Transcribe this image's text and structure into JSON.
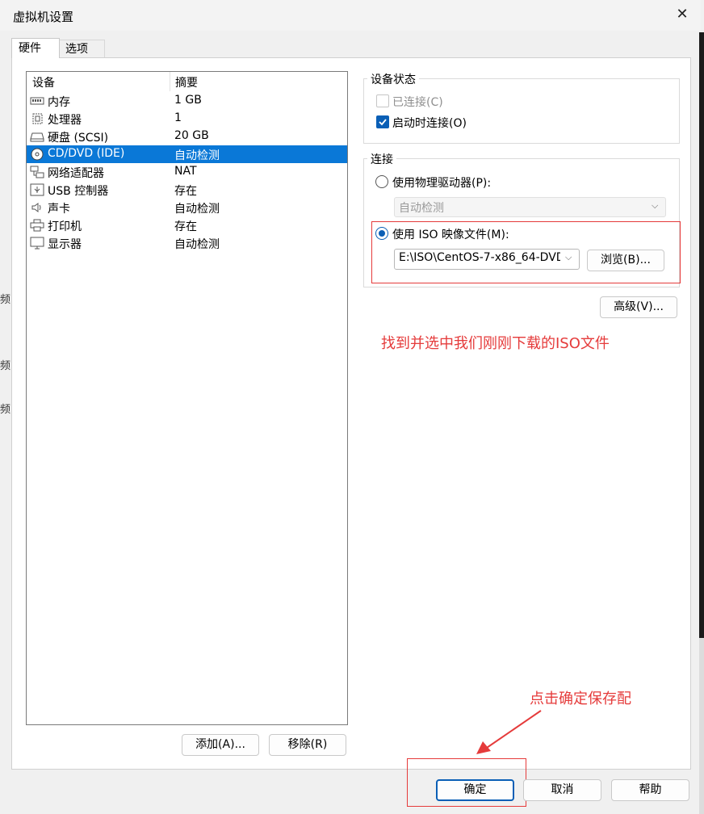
{
  "window": {
    "title": "虚拟机设置",
    "close_glyph": "✕"
  },
  "left_fragments": [
    "频",
    "频",
    "频"
  ],
  "tabs": [
    {
      "label": "硬件"
    },
    {
      "label": "选项"
    }
  ],
  "device_list": {
    "headers": {
      "device": "设备",
      "summary": "摘要"
    },
    "rows": [
      {
        "name": "内存",
        "summary": "1 GB",
        "icon": "memory-icon"
      },
      {
        "name": "处理器",
        "summary": "1",
        "icon": "processor-icon"
      },
      {
        "name": "硬盘 (SCSI)",
        "summary": "20 GB",
        "icon": "hard-disk-icon"
      },
      {
        "name": "CD/DVD (IDE)",
        "summary": "自动检测",
        "icon": "cd-dvd-icon",
        "selected": true
      },
      {
        "name": "网络适配器",
        "summary": "NAT",
        "icon": "network-adapter-icon"
      },
      {
        "name": "USB 控制器",
        "summary": "存在",
        "icon": "usb-icon"
      },
      {
        "name": "声卡",
        "summary": "自动检测",
        "icon": "speaker-icon"
      },
      {
        "name": "打印机",
        "summary": "存在",
        "icon": "printer-icon"
      },
      {
        "name": "显示器",
        "summary": "自动检测",
        "icon": "monitor-icon"
      }
    ],
    "add_button": "添加(A)...",
    "remove_button": "移除(R)"
  },
  "device_status": {
    "title": "设备状态",
    "connected_label": "已连接(C)",
    "connected_checked": false,
    "connect_on_start_label": "启动时连接(O)",
    "connect_on_start_checked": true
  },
  "connection": {
    "title": "连接",
    "physical_drive_label": "使用物理驱动器(P):",
    "physical_drive_value": "自动检测",
    "iso_label": "使用 ISO 映像文件(M):",
    "iso_path": "E:\\ISO\\CentOS-7-x86_64-DVD",
    "browse_button": "浏览(B)...",
    "selected": "iso"
  },
  "advanced_button": "高级(V)...",
  "annotations": {
    "iso_note": "找到并选中我们刚刚下载的ISO文件",
    "ok_note": "点击确定保存配",
    "color": "#e53b3b"
  },
  "dialog_buttons": {
    "ok": "确定",
    "cancel": "取消",
    "help": "帮助"
  },
  "colors": {
    "selection": "#0a78d7",
    "accent": "#0a5fb6",
    "annotation": "#e53b3b"
  }
}
